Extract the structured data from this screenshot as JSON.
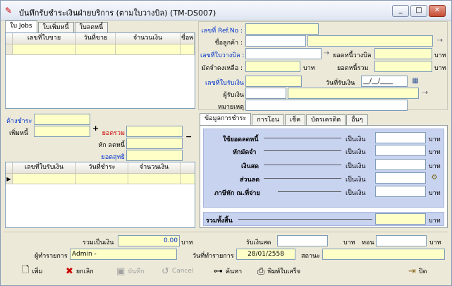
{
  "window": {
    "title": "บันทึกรับชำระเงินฝ่ายบริการ (ตามใบวางบิล) (TM-DS007)",
    "min": "_",
    "max": "□",
    "close": "✕"
  },
  "left_tabs": [
    "ใบ Jobs",
    "ใบเพิ่มหนี้",
    "ใบลดหนี้"
  ],
  "jobs_grid": {
    "headers": [
      "เลขที่ใบขาย",
      "วันที่ขาย",
      "จำนวนเงิน",
      "ชื่อพ"
    ]
  },
  "header_form": {
    "ref_no_label": "เลขที่ Ref.No :",
    "customer_label": "ชื่อลูกค้า :",
    "billing_no_label": "เลขที่ใบวางบิล :",
    "billing_total_label": "ยอดหนี้วางบิล",
    "deposit_label": "มัดจำคงเหลือ :",
    "debt_total_label": "ยอดหนี้รวม",
    "baht": "บาท",
    "receipt_no_label": "เลขที่ใบรับเงิน",
    "receipt_date_label": "วันที่รับเงิน",
    "receipt_date_value": "__/__/____",
    "receiver_label": "ผู้รับเงิน",
    "note_label": "หมายเหตุ"
  },
  "summary": {
    "outstanding_label": "ค้างชำระ",
    "add_debt_label": "เพิ่มหนี้",
    "plus": "+",
    "total_label": "ยอดรวม",
    "minus": "−",
    "reduce_debt_label": "หัก ลดหนี้",
    "net_label": "ยอดสุทธิ"
  },
  "receipt_grid": {
    "headers": [
      "เลขที่ใบรับเงิน",
      "วันที่ชำระ",
      "จำนวนเงิน"
    ]
  },
  "pay_tabs": [
    "ข้อมูลการชำระ",
    "การโอน",
    "เช็ค",
    "บัตรเครดิต",
    "อื่นๆ"
  ],
  "pay_rows": [
    {
      "label": "ใช้ยอดลดหนี้",
      "unit_label": "เป็นเงิน",
      "baht": "บาท"
    },
    {
      "label": "หักมัดจำ",
      "unit_label": "เป็นเงิน",
      "baht": "บาท"
    },
    {
      "label": "เงินสด",
      "unit_label": "เป็นเงิน",
      "baht": "บาท"
    },
    {
      "label": "ส่วนลด",
      "unit_label": "เป็นเงิน",
      "baht": "บาท"
    },
    {
      "label": "ภาษีหัก ณ.ที่จ่าย",
      "unit_label": "เป็นเงิน",
      "baht": "บาท"
    }
  ],
  "pay_total": {
    "label": "รวมทั้งสิ้น",
    "baht": "บาท"
  },
  "footer": {
    "sum_label": "รวมเป็นเงิน",
    "sum_value": "0.00",
    "sum_unit": "บาท",
    "cash_in_label": "รับเงินสด",
    "cash_in_unit": "บาท",
    "change_label": "ทอน",
    "change_unit": "บาท",
    "operator_label": "ผู้ทำรายการ",
    "operator_value": "Admin -",
    "date_label": "วันที่ทำรายการ",
    "date_value": "28/01/2558",
    "status_label": "สถานะ"
  },
  "toolbar": {
    "add": "เพิ่ม",
    "cancel_doc": "ยกเลิก",
    "save": "บันทึก",
    "cancel": "Cancel",
    "search": "ค้นหา",
    "print": "พิมพ์ใบเสร็จ",
    "close": "ปิด"
  }
}
